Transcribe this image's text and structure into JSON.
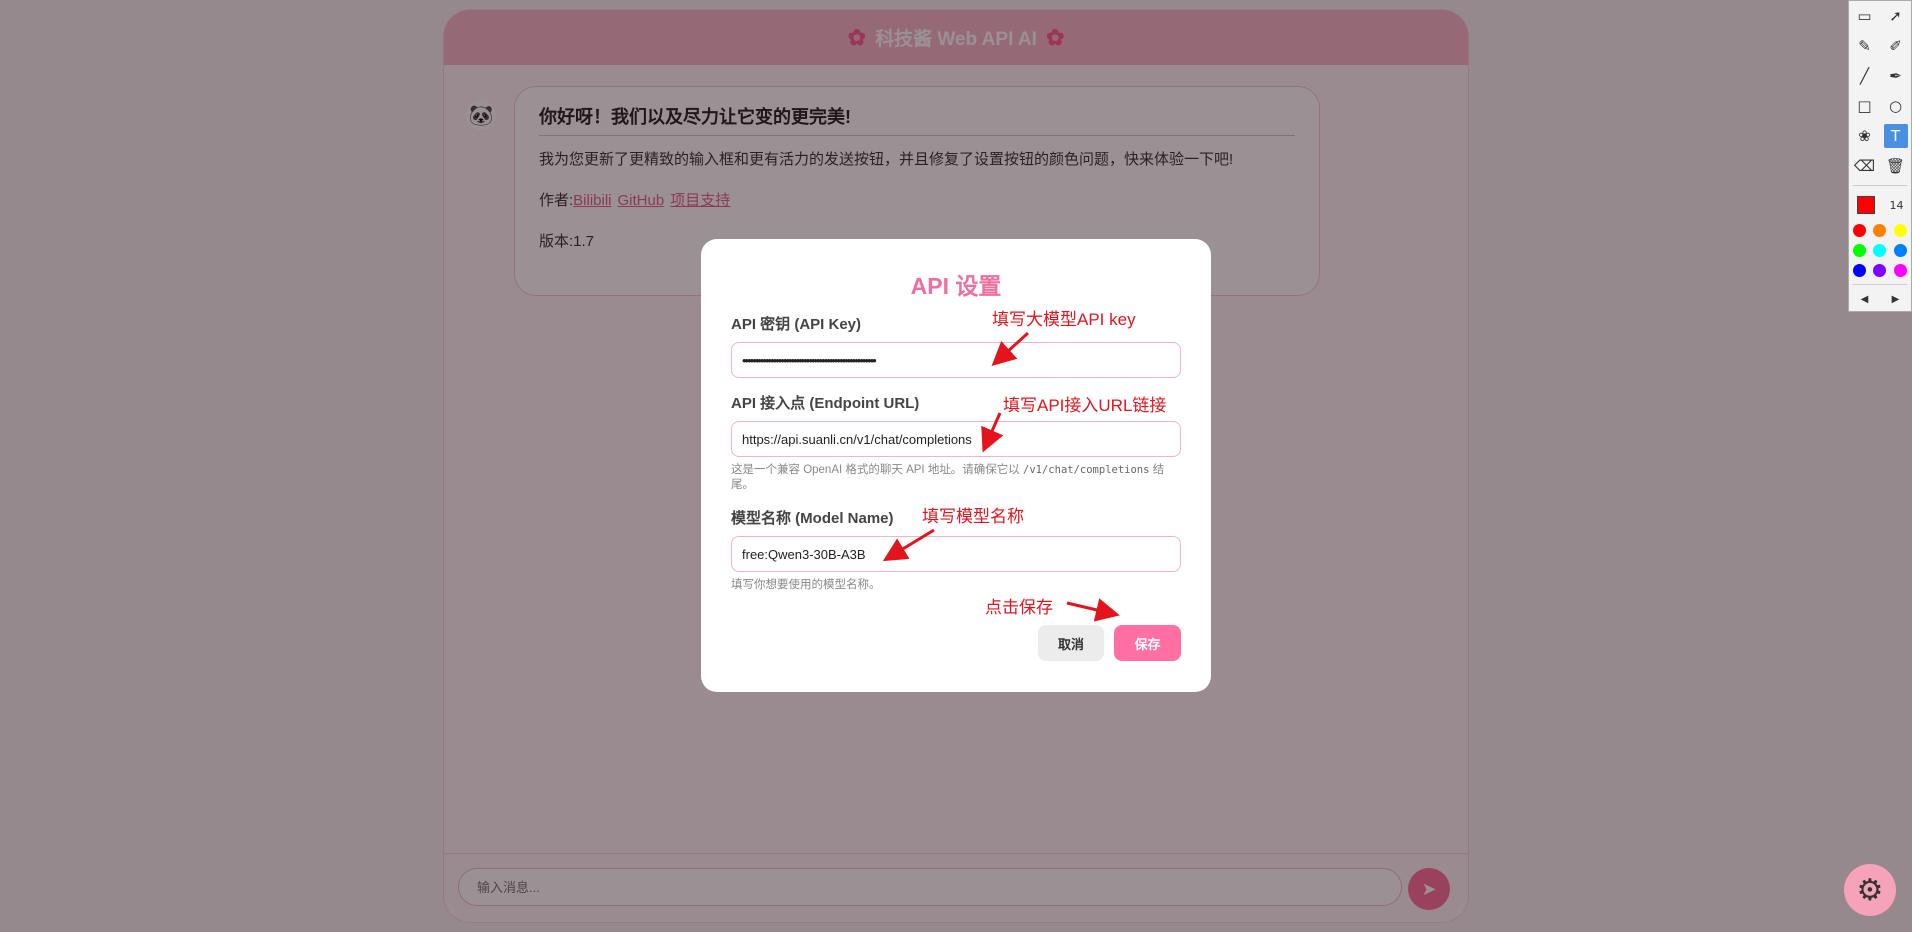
{
  "app": {
    "title": "科技酱 Web API AI",
    "flower": "✿",
    "avatar": "🐼",
    "welcome": {
      "heading": "你好呀！我们以及尽力让它变的更完美!",
      "body": "我为您更新了更精致的输入框和更有活力的发送按钮，并且修复了设置按钮的颜色问题，快来体验一下吧!",
      "author_label": "作者:",
      "links": [
        "Bilibili",
        "GitHub",
        "项目支持"
      ],
      "version": "版本:1.7"
    },
    "input_placeholder": "输入消息...",
    "send_icon": "➤",
    "settings_icon": "⚙"
  },
  "modal": {
    "title": "API 设置",
    "api_key": {
      "label": "API 密钥 (API Key)",
      "value": "••••••••••••••••••••••••••••••••••••••••••••••••••••"
    },
    "endpoint": {
      "label": "API 接入点 (Endpoint URL)",
      "value": "https://api.suanli.cn/v1/chat/completions",
      "hint_before": "这是一个兼容 OpenAI 格式的聊天 API 地址。请确保它以",
      "hint_code": "/v1/chat/completions",
      "hint_after": "结尾。"
    },
    "model": {
      "label": "模型名称 (Model Name)",
      "value": "free:Qwen3-30B-A3B",
      "hint": "填写你想要使用的模型名称。"
    },
    "cancel_label": "取消",
    "save_label": "保存"
  },
  "annotations": {
    "api_key": "填写大模型API key",
    "endpoint": "填写API接入URL链接",
    "model": "填写模型名称",
    "save": "点击保存",
    "color": "#e4141d"
  },
  "toolbar": {
    "tools": [
      "screen-icon",
      "cursor-icon",
      "pencil-icon",
      "marker-icon",
      "line-icon",
      "pen-icon",
      "rectangle-icon",
      "ellipse-icon",
      "blur-icon",
      "text-icon",
      "eraser-icon",
      "trash-icon"
    ],
    "active_tool": "text-icon",
    "current_color": "#ff0000",
    "size": "14",
    "palette": [
      "#ff0000",
      "#ff8000",
      "#ffff00",
      "#00ff00",
      "#00ffff",
      "#0080ff",
      "#0000ff",
      "#8000ff",
      "#ff00ff"
    ]
  }
}
